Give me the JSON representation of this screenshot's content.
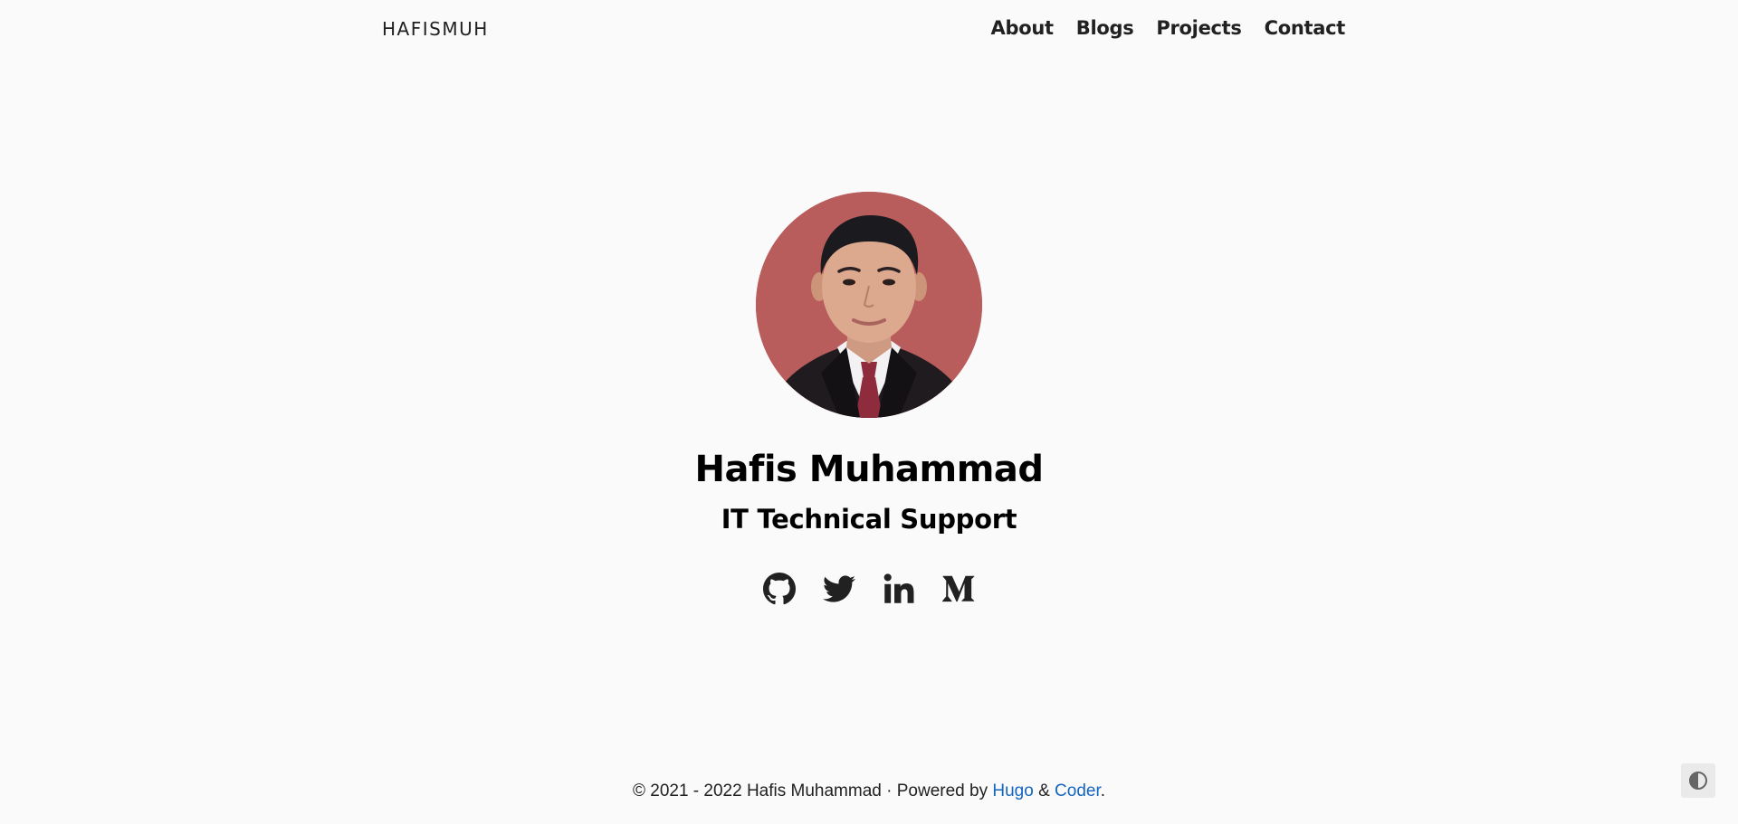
{
  "nav": {
    "brand": "HAFISMUH",
    "links": [
      "About",
      "Blogs",
      "Projects",
      "Contact"
    ]
  },
  "profile": {
    "name": "Hafis Muhammad",
    "role": "IT Technical Support",
    "avatar_background": "#b95c5c"
  },
  "social": [
    {
      "icon": "github-icon"
    },
    {
      "icon": "twitter-icon"
    },
    {
      "icon": "linkedin-icon"
    },
    {
      "icon": "medium-icon"
    }
  ],
  "footer": {
    "copyright": "© 2021 - 2022 Hafis Muhammad · Powered by",
    "hugo": "Hugo",
    "amp": "&",
    "coder": "Coder",
    "period": ".",
    "link_color": "#1565c0"
  },
  "colors": {
    "background": "#fafafa",
    "text": "#212121"
  }
}
